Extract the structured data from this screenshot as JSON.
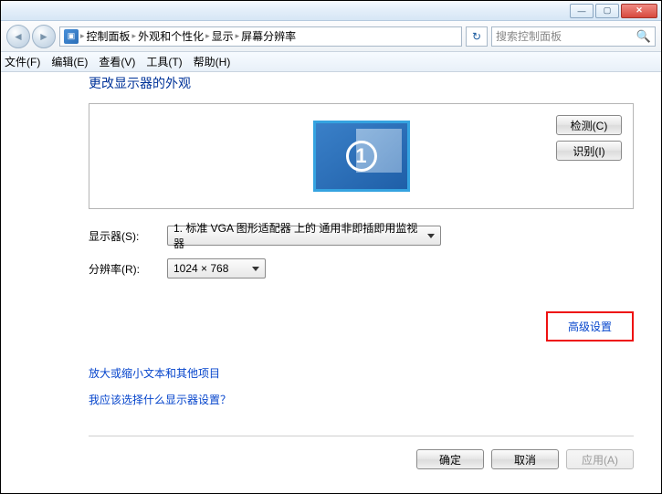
{
  "titlebar": {
    "min": "—",
    "max": "▢",
    "close": "✕"
  },
  "nav": {
    "back": "◄",
    "fwd": "►",
    "crumbs": [
      "控制面板",
      "外观和个性化",
      "显示",
      "屏幕分辨率"
    ],
    "refresh": "↻",
    "search_placeholder": "搜索控制面板"
  },
  "menu": {
    "file": "文件(F)",
    "edit": "编辑(E)",
    "view": "查看(V)",
    "tools": "工具(T)",
    "help": "帮助(H)"
  },
  "page": {
    "title": "更改显示器的外观",
    "monitor_number": "1",
    "detect": "检测(C)",
    "identify": "识别(I)",
    "display_label": "显示器(S):",
    "display_value": "1. 标准 VGA 图形适配器 上的 通用非即插即用监视器",
    "resolution_label": "分辨率(R):",
    "resolution_value": "1024 × 768",
    "advanced": "高级设置",
    "link_text_size": "放大或缩小文本和其他项目",
    "link_which_display": "我应该选择什么显示器设置？",
    "ok": "确定",
    "cancel": "取消",
    "apply": "应用(A)"
  }
}
